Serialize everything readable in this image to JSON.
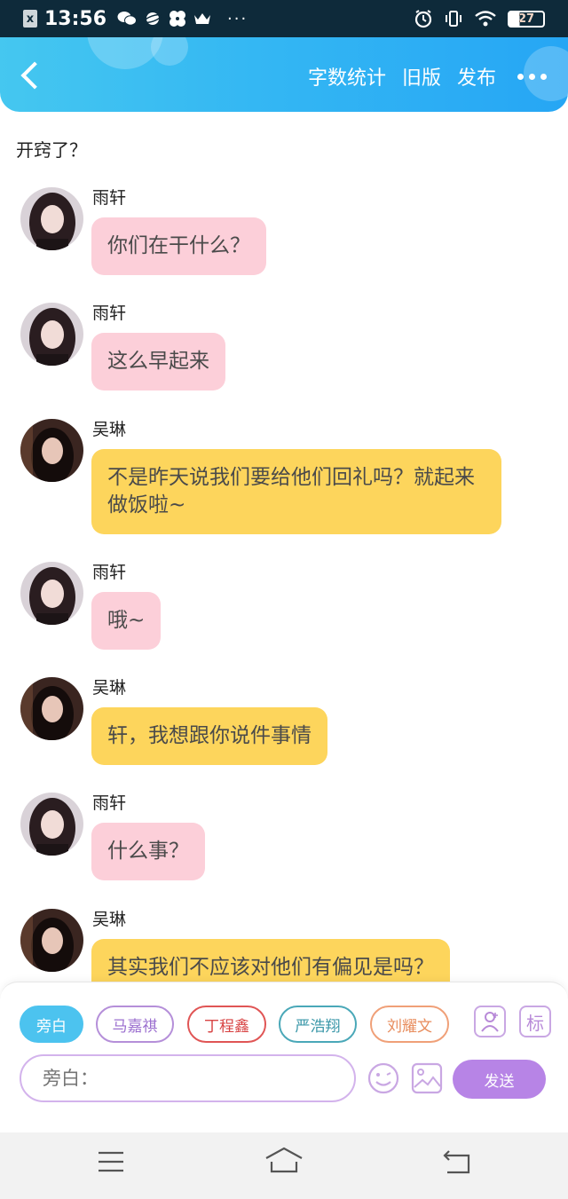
{
  "status_bar": {
    "time": "13:56",
    "battery": "27",
    "more": "···",
    "icons": [
      "x-app-icon",
      "wechat-icon",
      "planet-icon",
      "flower-icon",
      "crown-icon",
      "alarm-icon",
      "vibrate-icon",
      "wifi-icon",
      "battery-icon"
    ]
  },
  "header": {
    "word_count": "字数统计",
    "old_version": "旧版",
    "publish": "发布",
    "back_icon": "back-chevron-icon",
    "more_icon": "more-dots-icon"
  },
  "chat": {
    "title": "开窍了？",
    "messages": [
      {
        "sender": "雨轩",
        "text": "你们在干什么？",
        "style": "pink"
      },
      {
        "sender": "雨轩",
        "text": "这么早起来",
        "style": "pink"
      },
      {
        "sender": "吴琳",
        "text": "不是昨天说我们要给他们回礼吗？就起来做饭啦~",
        "style": "yellow"
      },
      {
        "sender": "雨轩",
        "text": "哦~",
        "style": "pink"
      },
      {
        "sender": "吴琳",
        "text": "轩，我想跟你说件事情",
        "style": "yellow"
      },
      {
        "sender": "雨轩",
        "text": "什么事？",
        "style": "pink"
      },
      {
        "sender": "吴琳",
        "text": "其实我们不应该对他们有偏见是吗？",
        "style": "yellow"
      }
    ]
  },
  "panel": {
    "roles": [
      {
        "label": "旁白",
        "color": "#4cc3ef",
        "selected": true
      },
      {
        "label": "马嘉祺",
        "color": "#b58fd9"
      },
      {
        "label": "丁程鑫",
        "color": "#e05555"
      },
      {
        "label": "严浩翔",
        "color": "#4aa8b8"
      },
      {
        "label": "刘耀文",
        "color": "#f0a078"
      }
    ],
    "tag_label": "标",
    "input_placeholder": "旁白：",
    "send": "发送",
    "colors": {
      "accent": "#b784e6",
      "pink_bubble": "#fccfd9",
      "yellow_bubble": "#fdd55c",
      "header": "#34b7f3"
    }
  },
  "nav": {
    "icons": [
      "menu-icon",
      "home-icon",
      "back-icon"
    ]
  }
}
